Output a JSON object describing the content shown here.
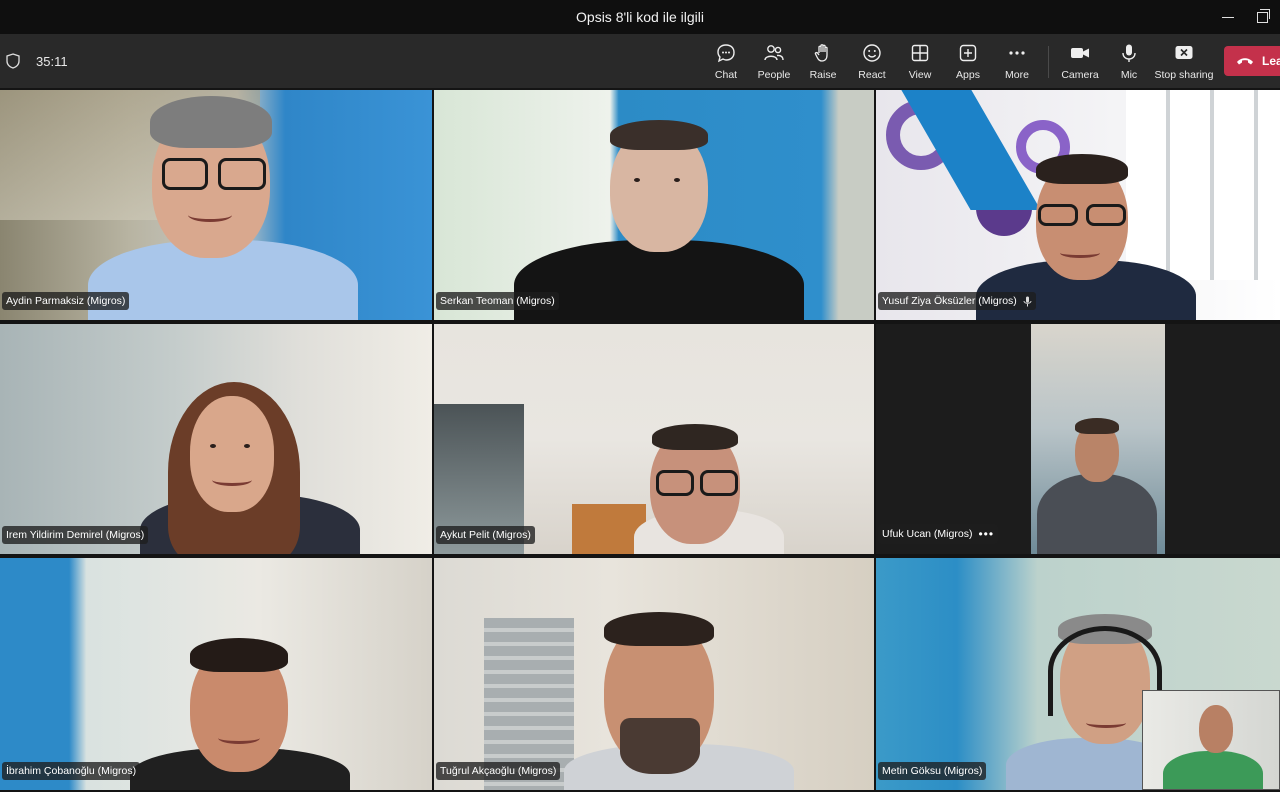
{
  "window": {
    "title": "Opsis 8'li kod ile ilgili"
  },
  "meeting": {
    "timer": "35:11"
  },
  "toolbar": {
    "chat": "Chat",
    "people": "People",
    "raise": "Raise",
    "react": "React",
    "view": "View",
    "apps": "Apps",
    "more": "More",
    "camera": "Camera",
    "mic": "Mic",
    "stop_sharing": "Stop sharing",
    "leave": "Lea"
  },
  "participants": [
    {
      "name": "Aydin Parmaksiz (Migros)"
    },
    {
      "name": "Serkan Teoman (Migros)"
    },
    {
      "name": "Yusuf Ziya Öksüzler (Migros)"
    },
    {
      "name": "Irem Yildirim Demirel (Migros)"
    },
    {
      "name": "Aykut Pelit (Migros)"
    },
    {
      "name": "Ufuk Ucan (Migros)",
      "more": "•••"
    },
    {
      "name": "İbrahim Çobanoğlu (Migros)"
    },
    {
      "name": "Tuğrul Akçaoğlu (Migros)"
    },
    {
      "name": "Metin Göksu (Migros)"
    }
  ],
  "colors": {
    "leave": "#c4314b",
    "toolbar": "#292929",
    "titlebar": "#0f0f0f"
  }
}
